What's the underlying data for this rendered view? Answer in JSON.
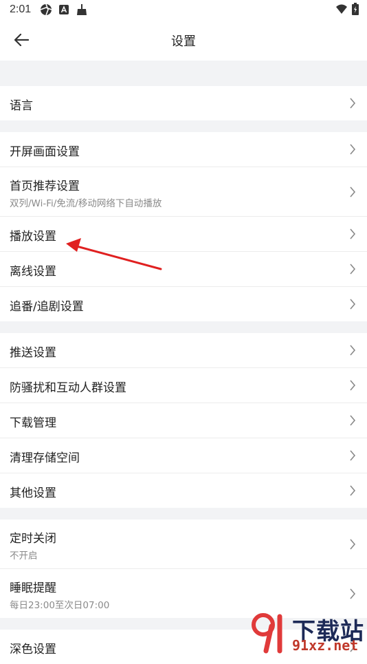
{
  "status_bar": {
    "time": "2:01"
  },
  "app_bar": {
    "title": "设置"
  },
  "groups": [
    {
      "items": [
        {
          "label": "语言"
        }
      ]
    },
    {
      "items": [
        {
          "label": "开屏画面设置"
        },
        {
          "label": "首页推荐设置",
          "sub": "双列/Wi-Fi/免流/移动网络下自动播放"
        },
        {
          "label": "播放设置"
        },
        {
          "label": "离线设置"
        },
        {
          "label": "追番/追剧设置"
        }
      ]
    },
    {
      "items": [
        {
          "label": "推送设置"
        },
        {
          "label": "防骚扰和互动人群设置"
        },
        {
          "label": "下载管理"
        },
        {
          "label": "清理存储空间"
        },
        {
          "label": "其他设置"
        }
      ]
    },
    {
      "items": [
        {
          "label": "定时关闭",
          "sub": "不开启"
        },
        {
          "label": "睡眠提醒",
          "sub": "每日23:00至次日07:00"
        }
      ]
    },
    {
      "items": [
        {
          "label": "深色设置"
        }
      ]
    }
  ],
  "annotation": {
    "color": "#e02020"
  },
  "watermark": {
    "text": "下载站",
    "url": "91xz.net"
  }
}
